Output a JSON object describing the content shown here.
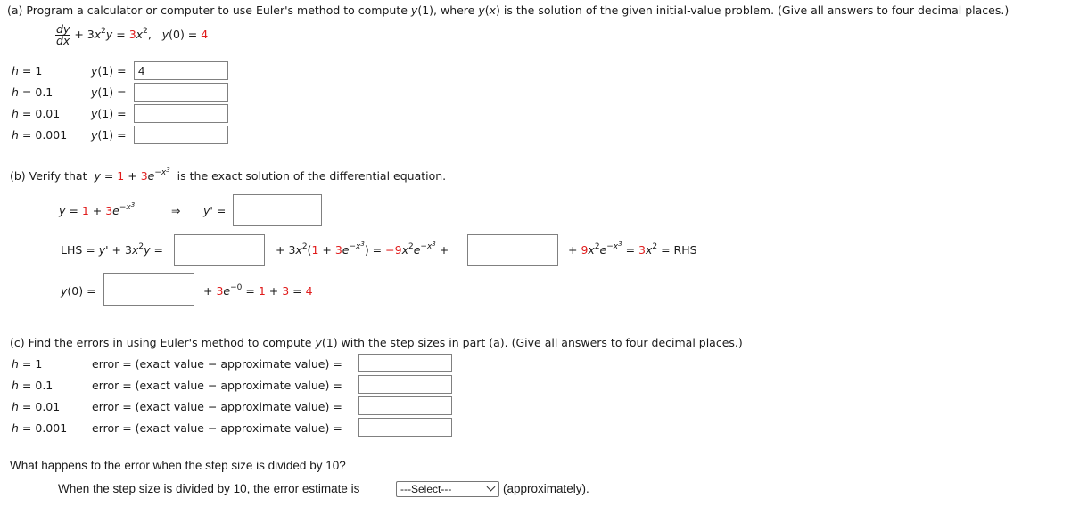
{
  "part_a": {
    "instruction": "(a) Program a calculator or computer to use Euler's method to compute y(1), where y(x) is the solution of the given initial-value problem. (Give all answers to four decimal places.)",
    "instruction_parts": [
      "(a) Program a calculator or computer to use Euler's method to compute ",
      "y",
      "(1), where ",
      "y",
      "(",
      "x",
      ") is the solution of the given initial-value problem. (Give all answers to four decimal places.)"
    ],
    "equation": {
      "frac_num": "dy",
      "frac_den": "dx",
      "lhs_rest": "+ 3x²y =",
      "rhs_coef": "3",
      "rhs_var": "x",
      "rhs_exp": "2",
      "ic_label": "y(0) =",
      "ic_value": "4"
    },
    "rows": [
      {
        "h_label": "h",
        "h_value": "= 1",
        "y_label": "y(1) =",
        "answer": "4"
      },
      {
        "h_label": "h",
        "h_value": "= 0.1",
        "y_label": "y(1) =",
        "answer": ""
      },
      {
        "h_label": "h",
        "h_value": "= 0.01",
        "y_label": "y(1) =",
        "answer": ""
      },
      {
        "h_label": "h",
        "h_value": "= 0.001",
        "y_label": "y(1) =",
        "answer": ""
      }
    ]
  },
  "part_b": {
    "prefix": "(b) Verify that",
    "suffix": "is the exact solution of the differential equation.",
    "solution": {
      "y": "y",
      "eq": "=",
      "one": "1",
      "plus": "+",
      "three": "3",
      "e": "e",
      "exp": "−x",
      "exp_pow": "3"
    },
    "implies": "⇒",
    "yprime_label": "y' =",
    "yprime_answer": "",
    "lhs_label": "LHS = y' + 3x²y =",
    "lhs_answer": "",
    "middle_text": {
      "plus3x2": "+ 3x",
      "pow2": "2",
      "open": "(",
      "one": "1",
      "plus": " + ",
      "three": "3",
      "e": "e",
      "exp": "−x",
      "exp_pow": "3",
      "close": ") =",
      "neg9": "−9",
      "x2e": "x",
      "e2": "e",
      "plus_end": "+"
    },
    "second_answer": "",
    "end_text": {
      "plus": "+",
      "nine": "9",
      "x": "x",
      "e": "e",
      "exp": "−x",
      "exp_pow": "3",
      "eq": "=",
      "three": "3",
      "x2": "x",
      "pow": "2",
      "rhs": "= RHS"
    },
    "y0_label": "y(0) =",
    "y0_answer": "",
    "y0_tail": {
      "plus": "+",
      "three": "3",
      "e": "e",
      "exp": "−0",
      "eq": "=",
      "one": "1",
      "plus2": "+",
      "three2": "3",
      "eq2": "=",
      "four": "4"
    }
  },
  "part_c": {
    "instruction": "(c) Find the errors in using Euler's method to compute y(1) with the step sizes in part (a). (Give all answers to four decimal places.)",
    "instruction_pre": "(c) Find the errors in using Euler's method to compute ",
    "instruction_y": "y",
    "instruction_post": "(1) with the step sizes in part (a). (Give all answers to four decimal places.)",
    "rows": [
      {
        "h_label": "h",
        "h_value": "= 1",
        "error_label": "error = (exact value − approximate value) =",
        "answer": ""
      },
      {
        "h_label": "h",
        "h_value": "= 0.1",
        "error_label": "error = (exact value − approximate value) =",
        "answer": ""
      },
      {
        "h_label": "h",
        "h_value": "= 0.01",
        "error_label": "error = (exact value − approximate value) =",
        "answer": ""
      },
      {
        "h_label": "h",
        "h_value": "= 0.001",
        "error_label": "error = (exact value − approximate value) =",
        "answer": ""
      }
    ]
  },
  "question": {
    "text": "What happens to the error when the step size is divided by 10?",
    "sentence_pre": "When the step size is divided by 10, the error estimate is",
    "select_value": "---Select---",
    "sentence_post": "(approximately)."
  }
}
